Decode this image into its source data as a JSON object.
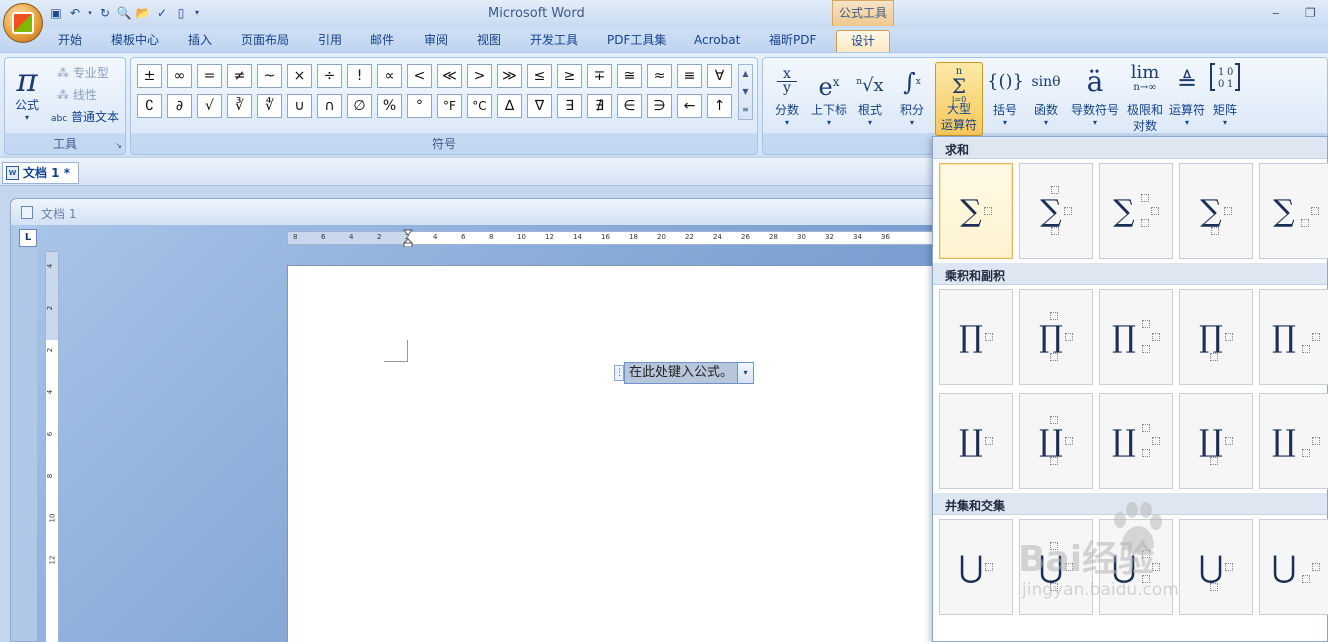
{
  "window": {
    "app_title": "Microsoft Word",
    "context_tool": "公式工具"
  },
  "tabs": [
    "开始",
    "模板中心",
    "插入",
    "页面布局",
    "引用",
    "邮件",
    "审阅",
    "视图",
    "开发工具",
    "PDF工具集",
    "Acrobat",
    "福昕PDF",
    "设计"
  ],
  "active_tab": "设计",
  "ribbon": {
    "tools_group": {
      "label": "工具",
      "formula_label": "公式",
      "professional": "专业型",
      "linear": "线性",
      "normal_text": "普通文本",
      "normal_text_prefix": "abc"
    },
    "symbols_group": {
      "label": "符号",
      "row1": [
        "±",
        "∞",
        "=",
        "≠",
        "~",
        "×",
        "÷",
        "!",
        "∝",
        "<",
        "≪",
        ">",
        "≫",
        "≤",
        "≥",
        "∓",
        "≅",
        "≈",
        "≡",
        "∀"
      ],
      "row2": [
        "∁",
        "∂",
        "√",
        "∛",
        "∜",
        "∪",
        "∩",
        "∅",
        "%",
        "°",
        "°F",
        "°C",
        "∆",
        "∇",
        "∃",
        "∄",
        "∈",
        "∋",
        "←",
        "↑"
      ]
    },
    "structures": [
      {
        "label": "分数",
        "label2": ""
      },
      {
        "label": "上下标",
        "label2": ""
      },
      {
        "label": "根式",
        "label2": ""
      },
      {
        "label": "积分",
        "label2": ""
      },
      {
        "label": "大型",
        "label2": "运算符"
      },
      {
        "label": "括号",
        "label2": ""
      },
      {
        "label": "函数",
        "label2": ""
      },
      {
        "label": "导数符号",
        "label2": ""
      },
      {
        "label": "极限和",
        "label2": "对数"
      },
      {
        "label": "运算符",
        "label2": ""
      },
      {
        "label": "矩阵",
        "label2": ""
      }
    ],
    "structure_glyphs": {
      "fraction_num": "x",
      "fraction_den": "y",
      "script_base": "e",
      "script_sup": "x",
      "radical_index": "n",
      "radical_body": "√x",
      "integral": "∫",
      "integral_sup": "x",
      "integral_sub": "-x",
      "sum_top": "n",
      "sum_sign": "Σ",
      "sum_bottom": "i=0",
      "bracket": "{()}",
      "function": "sinθ",
      "accent": "ä",
      "limit_top": "lim",
      "limit_bottom": "n→∞",
      "operator": "≜",
      "matrix": "[1 0; 0 1]"
    }
  },
  "document": {
    "tab_label": "文档 1 *",
    "window_title": "文档 1",
    "equation_placeholder": "在此处键入公式。",
    "hruler_ticks": [
      "8",
      "6",
      "4",
      "2",
      "2",
      "4",
      "6",
      "8",
      "10",
      "12",
      "14",
      "16",
      "18",
      "20",
      "22",
      "24",
      "26",
      "28",
      "30",
      "32",
      "34",
      "36"
    ],
    "vruler_ticks": [
      "4",
      "2",
      "2",
      "4",
      "6",
      "8",
      "10",
      "12"
    ]
  },
  "gallery": {
    "sections": [
      {
        "title": "求和",
        "operator": "∑",
        "rows": 1
      },
      {
        "title": "乘积和副积",
        "operator": "∏",
        "operator2": "∐",
        "rows": 2
      },
      {
        "title": "并集和交集",
        "operator": "⋃",
        "rows": 1
      }
    ]
  },
  "watermark": {
    "text": "Bai经验",
    "url": "jingyan.baidu.com"
  }
}
